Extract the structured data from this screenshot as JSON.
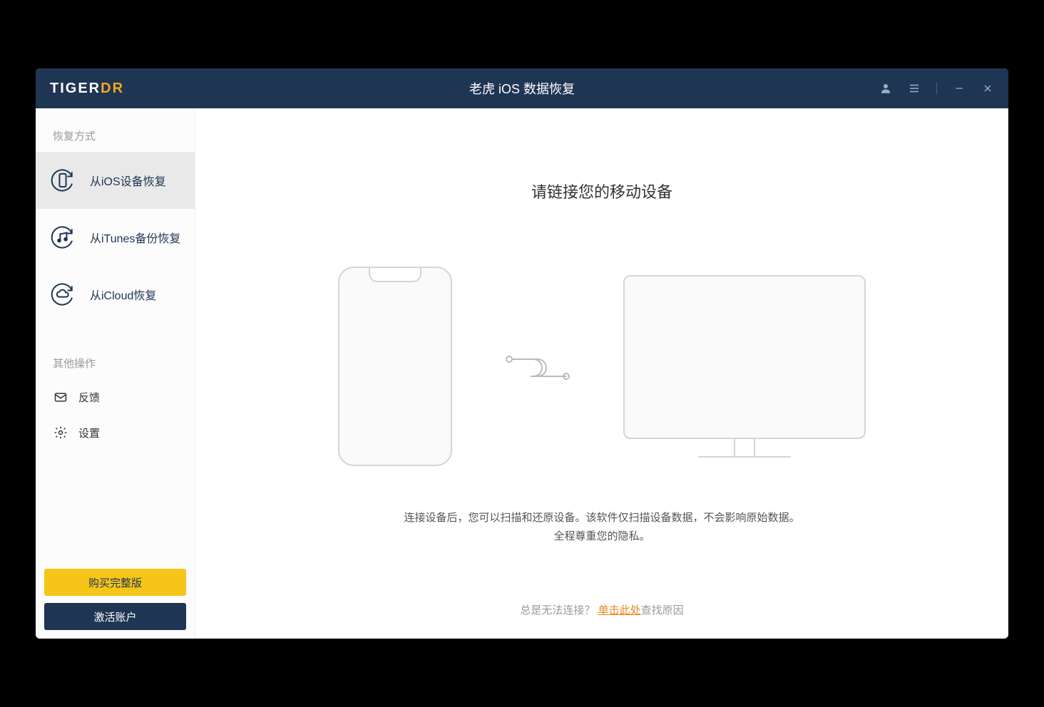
{
  "titlebar": {
    "logo_prefix": "TIGER",
    "logo_suffix": "DR",
    "title": "老虎 iOS 数据恢复"
  },
  "sidebar": {
    "section_recovery": "恢复方式",
    "items": [
      {
        "label": "从iOS设备恢复"
      },
      {
        "label": "从iTunes备份恢复"
      },
      {
        "label": "从iCloud恢复"
      }
    ],
    "section_other": "其他操作",
    "other_items": [
      {
        "label": "反馈"
      },
      {
        "label": "设置"
      }
    ],
    "buy_button": "购买完整版",
    "activate_button": "激活账户"
  },
  "main": {
    "heading": "请链接您的移动设备",
    "description_line1": "连接设备后，您可以扫描和还原设备。该软件仅扫描设备数据，不会影响原始数据。",
    "description_line2": "全程尊重您的隐私。",
    "footer_prefix": "总是无法连接？",
    "footer_link": "单击此处",
    "footer_suffix": "查找原因"
  }
}
